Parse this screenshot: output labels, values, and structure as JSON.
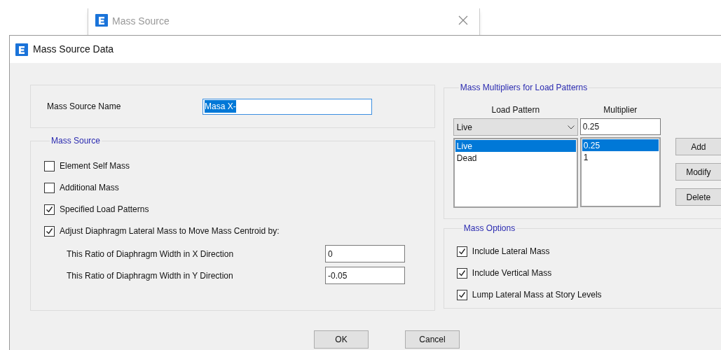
{
  "background_window": {
    "title": "Mass Source"
  },
  "dialog": {
    "title": "Mass Source Data"
  },
  "mass_source_name": {
    "label": "Mass Source Name",
    "value": "Masa X-",
    "value_highlighted": true
  },
  "mass_source": {
    "title": "Mass Source",
    "options": [
      {
        "label": "Element Self Mass",
        "checked": false
      },
      {
        "label": "Additional Mass",
        "checked": false
      },
      {
        "label": "Specified Load Patterns",
        "checked": true
      },
      {
        "label": "Adjust Diaphragm Lateral Mass to Move Mass Centroid by:",
        "checked": true
      }
    ],
    "ratios": [
      {
        "label": "This Ratio of Diaphragm Width in X Direction",
        "value": "0"
      },
      {
        "label": "This Ratio of Diaphragm Width in Y Direction",
        "value": "-0.05"
      }
    ]
  },
  "mass_multipliers": {
    "title": "Mass Multipliers for Load Patterns",
    "columns": [
      "Load Pattern",
      "Multiplier"
    ],
    "pattern_dropdown": "Live",
    "multiplier_value": "0.25",
    "rows": [
      {
        "load_pattern": "Live",
        "multiplier": "0.25",
        "selected": true
      },
      {
        "load_pattern": "Dead",
        "multiplier": "1",
        "selected": false
      }
    ],
    "buttons": [
      "Add",
      "Modify",
      "Delete"
    ]
  },
  "mass_options": {
    "title": "Mass Options",
    "options": [
      {
        "label": "Include Lateral Mass",
        "checked": true
      },
      {
        "label": "Include Vertical Mass",
        "checked": true
      },
      {
        "label": "Lump Lateral Mass at Story Levels",
        "checked": true
      }
    ]
  },
  "buttons": [
    "OK",
    "Cancel"
  ]
}
